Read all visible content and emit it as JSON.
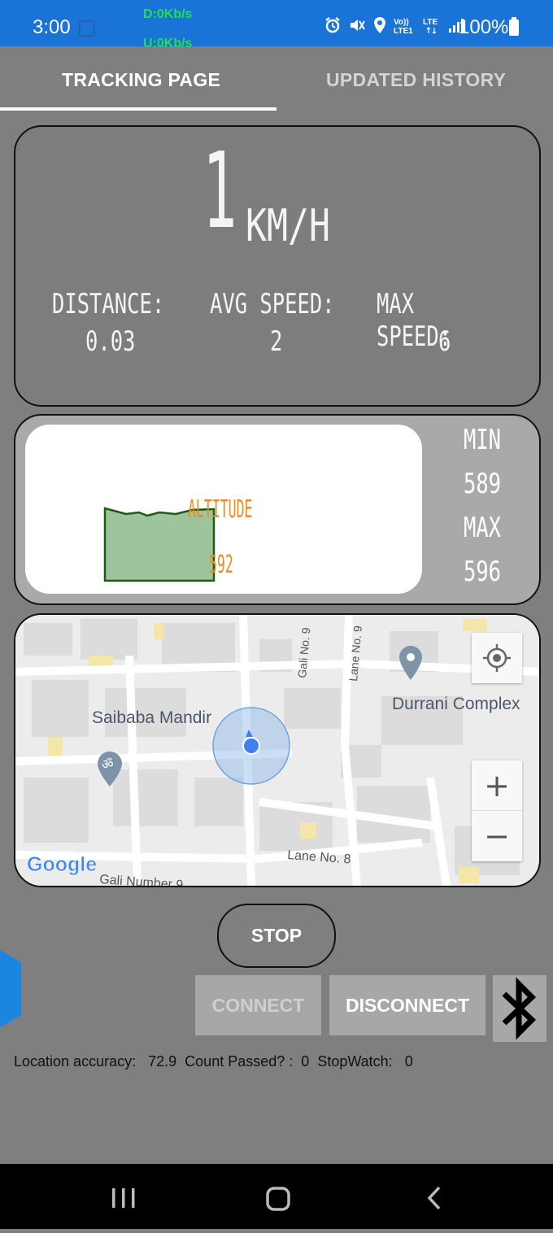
{
  "status_bar": {
    "time": "3:00",
    "download": "D:0Kb/s",
    "upload": "U:0Kb/s",
    "battery": "100%",
    "icons": [
      "alarm-icon",
      "mute-icon",
      "location-icon",
      "volte-icon",
      "lte-icon",
      "signal-icon",
      "battery-icon"
    ]
  },
  "tabs": [
    {
      "label": "TRACKING PAGE",
      "active": true
    },
    {
      "label": "UPDATED HISTORY",
      "active": false
    }
  ],
  "speed": {
    "value": "1",
    "unit": "KM/H",
    "distance_label": "DISTANCE:",
    "distance_value": "0.03",
    "avg_label": "AVG SPEED:",
    "avg_value": "2",
    "max_label": "MAX SPEED:",
    "max_value": "6"
  },
  "altitude": {
    "label": "ALTITUDE",
    "current": "592",
    "min_label": "MIN",
    "min_value": "589",
    "max_label": "MAX",
    "max_value": "596",
    "colors": {
      "fill": "#9dc49a",
      "stroke": "#1e5a12",
      "text": "#f08a1c"
    }
  },
  "map": {
    "labels": [
      "Saibaba Mandir",
      "Durrani Complex",
      "Gali No. 9",
      "Lane No. 9",
      "Lane No. 8",
      "Gali Number 9"
    ],
    "logo": "Google",
    "zoom_in": "+",
    "zoom_out": "−"
  },
  "controls": {
    "stop": "STOP",
    "connect": "CONNECT",
    "disconnect": "DISCONNECT"
  },
  "footer": {
    "accuracy_label": "Location accuracy:",
    "accuracy_value": "72.9",
    "count_label": "Count Passed? :",
    "count_value": "0",
    "stopwatch_label": "StopWatch:",
    "stopwatch_value": "0"
  }
}
